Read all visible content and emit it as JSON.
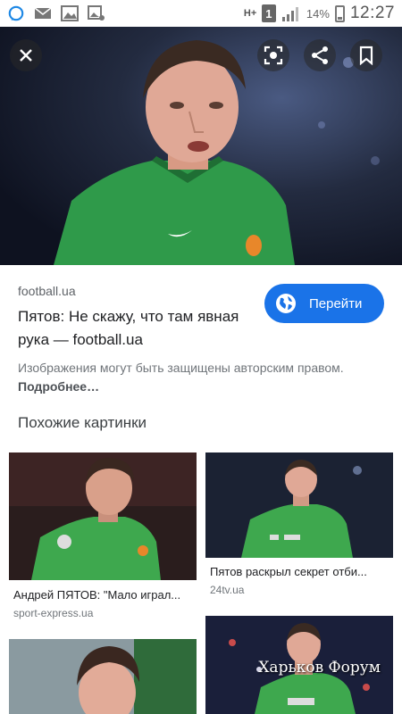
{
  "status_bar": {
    "network": "H+",
    "sim_slot": "1",
    "battery": "14%",
    "time": "12:27"
  },
  "hero": {
    "icons": [
      "close-icon",
      "lens-icon",
      "share-icon",
      "bookmark-icon"
    ]
  },
  "result": {
    "domain": "football.ua",
    "title": "Пятов: Не скажу, что там явная рука — football.ua",
    "visit_label": "Перейти",
    "copyright_text": "Изображения могут быть защищены авторским правом.",
    "more_link": "Подробнее…"
  },
  "related": {
    "heading": "Похожие картинки",
    "items": [
      {
        "caption": "Андрей ПЯТОВ: \"Мало играл...",
        "source": "sport-express.ua"
      },
      {
        "caption": "Пятов раскрыл секрет отби...",
        "source": "24tv.ua"
      },
      {
        "watermark": "Харьков Форум"
      }
    ]
  },
  "colors": {
    "accent": "#1a73e8",
    "jersey": "#2f9a4a"
  }
}
